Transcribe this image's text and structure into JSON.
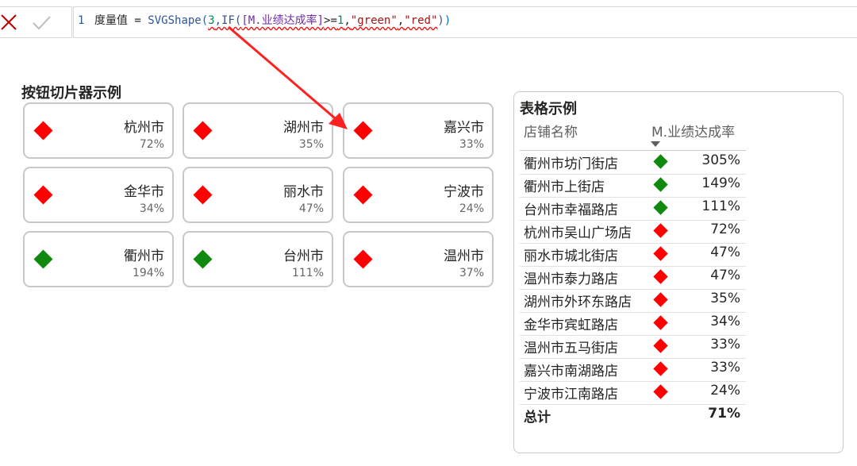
{
  "colors": {
    "green": "#0f8a0f",
    "red": "#ff0000",
    "arrow": "#ff2020"
  },
  "formula": {
    "line_number": "1",
    "tokens": [
      {
        "text": "度量值 = ",
        "cls": ""
      },
      {
        "text": "SVGShape",
        "cls": "t-func"
      },
      {
        "text": "(",
        "cls": "t-paren"
      },
      {
        "text": "3",
        "cls": "t-num wavy"
      },
      {
        "text": ",IF(",
        "cls": "t-func wavy"
      },
      {
        "text": "[M.业绩达成率]",
        "cls": "t-meas wavy"
      },
      {
        "text": ">=",
        "cls": "wavy"
      },
      {
        "text": "1",
        "cls": "t-num wavy"
      },
      {
        "text": ",",
        "cls": "wavy"
      },
      {
        "text": "\"green\"",
        "cls": "t-str wavy"
      },
      {
        "text": ",",
        "cls": "wavy"
      },
      {
        "text": "\"red\"",
        "cls": "t-str wavy"
      },
      {
        "text": ")",
        "cls": "t-func"
      },
      {
        "text": ")",
        "cls": "t-paren"
      }
    ]
  },
  "slicer": {
    "title": "按钮切片器示例",
    "buttons": [
      {
        "city": "杭州市",
        "pct": "72%",
        "color": "red"
      },
      {
        "city": "湖州市",
        "pct": "35%",
        "color": "red"
      },
      {
        "city": "嘉兴市",
        "pct": "33%",
        "color": "red"
      },
      {
        "city": "金华市",
        "pct": "34%",
        "color": "red"
      },
      {
        "city": "丽水市",
        "pct": "47%",
        "color": "red"
      },
      {
        "city": "宁波市",
        "pct": "24%",
        "color": "red"
      },
      {
        "city": "衢州市",
        "pct": "194%",
        "color": "green"
      },
      {
        "city": "台州市",
        "pct": "111%",
        "color": "green"
      },
      {
        "city": "温州市",
        "pct": "37%",
        "color": "red"
      }
    ]
  },
  "table": {
    "title": "表格示例",
    "col_store": "店铺名称",
    "col_measure": "M.业绩达成率",
    "rows": [
      {
        "store": "衢州市坊门街店",
        "value": "305%",
        "color": "green"
      },
      {
        "store": "衢州市上街店",
        "value": "149%",
        "color": "green"
      },
      {
        "store": "台州市幸福路店",
        "value": "111%",
        "color": "green"
      },
      {
        "store": "杭州市吴山广场店",
        "value": "72%",
        "color": "red"
      },
      {
        "store": "丽水市城北街店",
        "value": "47%",
        "color": "red"
      },
      {
        "store": "温州市泰力路店",
        "value": "47%",
        "color": "red"
      },
      {
        "store": "湖州市外环东路店",
        "value": "35%",
        "color": "red"
      },
      {
        "store": "金华市宾虹路店",
        "value": "34%",
        "color": "red"
      },
      {
        "store": "温州市五马街店",
        "value": "33%",
        "color": "red"
      },
      {
        "store": "嘉兴市南湖路店",
        "value": "33%",
        "color": "red"
      },
      {
        "store": "宁波市江南路店",
        "value": "24%",
        "color": "red"
      }
    ],
    "total_label": "总计",
    "total_value": "71%"
  }
}
